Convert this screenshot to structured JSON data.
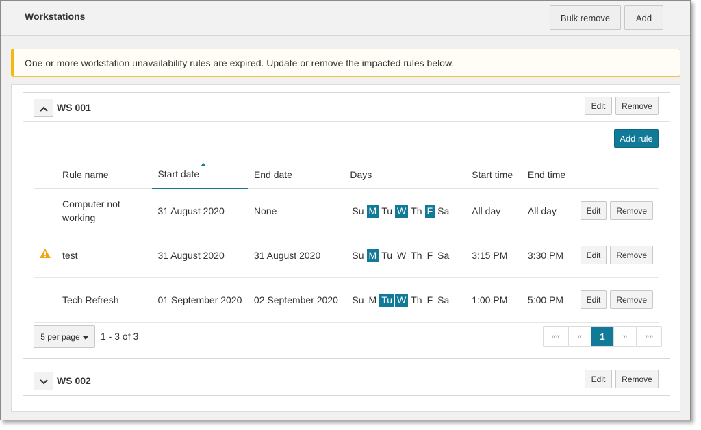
{
  "header": {
    "title": "Workstations",
    "bulk_remove": "Bulk remove",
    "add": "Add"
  },
  "alert": {
    "text": "One or more workstation unavailability rules are expired. Update or remove the impacted rules below."
  },
  "colors": {
    "accent": "#117a98",
    "warning": "#f5b90c"
  },
  "ws1": {
    "name": "WS 001",
    "expanded": true,
    "edit": "Edit",
    "remove": "Remove",
    "add_rule": "Add rule",
    "columns": {
      "rule_name": "Rule name",
      "start_date": "Start date",
      "end_date": "End date",
      "days": "Days",
      "start_time": "Start time",
      "end_time": "End time"
    },
    "rows": [
      {
        "warning": false,
        "rule_name": "Computer not working",
        "start_date": "31 August 2020",
        "end_date": "None",
        "days": [
          {
            "label": "Su",
            "on": false
          },
          {
            "label": "M",
            "on": true
          },
          {
            "label": "Tu",
            "on": false
          },
          {
            "label": "W",
            "on": true
          },
          {
            "label": "Th",
            "on": false
          },
          {
            "label": "F",
            "on": true
          },
          {
            "label": "Sa",
            "on": false
          }
        ],
        "start_time": "All day",
        "end_time": "All day",
        "edit": "Edit",
        "remove": "Remove"
      },
      {
        "warning": true,
        "rule_name": "test",
        "start_date": "31 August 2020",
        "end_date": "31 August 2020",
        "days": [
          {
            "label": "Su",
            "on": false
          },
          {
            "label": "M",
            "on": true
          },
          {
            "label": "Tu",
            "on": false
          },
          {
            "label": "W",
            "on": false
          },
          {
            "label": "Th",
            "on": false
          },
          {
            "label": "F",
            "on": false
          },
          {
            "label": "Sa",
            "on": false
          }
        ],
        "start_time": "3:15 PM",
        "end_time": "3:30 PM",
        "edit": "Edit",
        "remove": "Remove"
      },
      {
        "warning": false,
        "rule_name": "Tech Refresh",
        "start_date": "01 September 2020",
        "end_date": "02 September 2020",
        "days": [
          {
            "label": "Su",
            "on": false
          },
          {
            "label": "M",
            "on": false
          },
          {
            "label": "Tu",
            "on": true
          },
          {
            "label": "W",
            "on": true
          },
          {
            "label": "Th",
            "on": false
          },
          {
            "label": "F",
            "on": false
          },
          {
            "label": "Sa",
            "on": false
          }
        ],
        "start_time": "1:00 PM",
        "end_time": "5:00 PM",
        "edit": "Edit",
        "remove": "Remove"
      }
    ],
    "pager": {
      "per_page": "5 per page",
      "range": "1 - 3 of 3",
      "first": "««",
      "prev": "«",
      "current": "1",
      "next": "»",
      "last": "»»"
    }
  },
  "ws2": {
    "name": "WS 002",
    "expanded": false,
    "edit": "Edit",
    "remove": "Remove"
  }
}
